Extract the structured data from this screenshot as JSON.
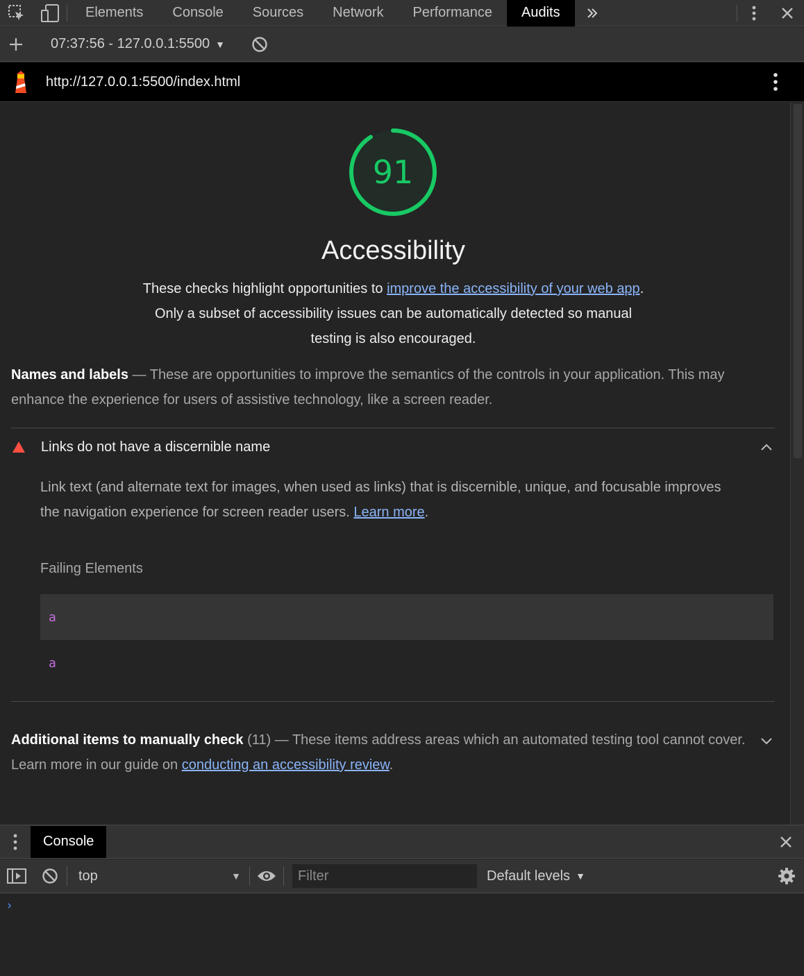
{
  "devtools": {
    "tabs": [
      {
        "label": "Elements",
        "active": false
      },
      {
        "label": "Console",
        "active": false
      },
      {
        "label": "Sources",
        "active": false
      },
      {
        "label": "Network",
        "active": false
      },
      {
        "label": "Performance",
        "active": false
      },
      {
        "label": "Audits",
        "active": true
      }
    ],
    "icons": {
      "inspect": "inspect-element-icon",
      "device": "device-toolbar-icon",
      "more_tabs": "double-chevron-right-icon",
      "menu": "kebab-menu-icon",
      "close": "close-icon"
    }
  },
  "report_bar": {
    "new_audit_icon": "plus-icon",
    "report_label": "07:37:56 - 127.0.0.1:5500",
    "clear_icon": "block-icon"
  },
  "url_bar": {
    "url": "http://127.0.0.1:5500/index.html",
    "logo_icon": "lighthouse-icon",
    "menu_icon": "kebab-menu-icon"
  },
  "category": {
    "score": "91",
    "score_color": "#18c964",
    "title": "Accessibility",
    "desc_before": "These checks highlight opportunities to ",
    "desc_link": "improve the accessibility of your web app",
    "desc_after": ". Only a subset of accessibility issues can be automatically detected so manual testing is also encouraged."
  },
  "group": {
    "title": "Names and labels",
    "separator": " — ",
    "description": "These are opportunities to improve the semantics of the controls in your application. This may enhance the experience for users of assistive technology, like a screen reader."
  },
  "audit": {
    "title": "Links do not have a discernible name",
    "status_color": "#ff4e42",
    "desc_text": "Link text (and alternate text for images, when used as links) that is discernible, unique, and focusable improves the navigation experience for screen reader users. ",
    "learn_more": "Learn more",
    "desc_end": ".",
    "failing_label": "Failing Elements",
    "nodes": [
      "a",
      "a"
    ]
  },
  "manual": {
    "title": "Additional items to manually check",
    "count": "(11)",
    "separator": " — ",
    "desc_text": "These items address areas which an automated testing tool cannot cover. Learn more in our guide on ",
    "link": "conducting an accessibility review",
    "desc_end": "."
  },
  "drawer": {
    "tab_label": "Console",
    "context": "top",
    "filter_placeholder": "Filter",
    "levels": "Default levels",
    "prompt": "›"
  }
}
